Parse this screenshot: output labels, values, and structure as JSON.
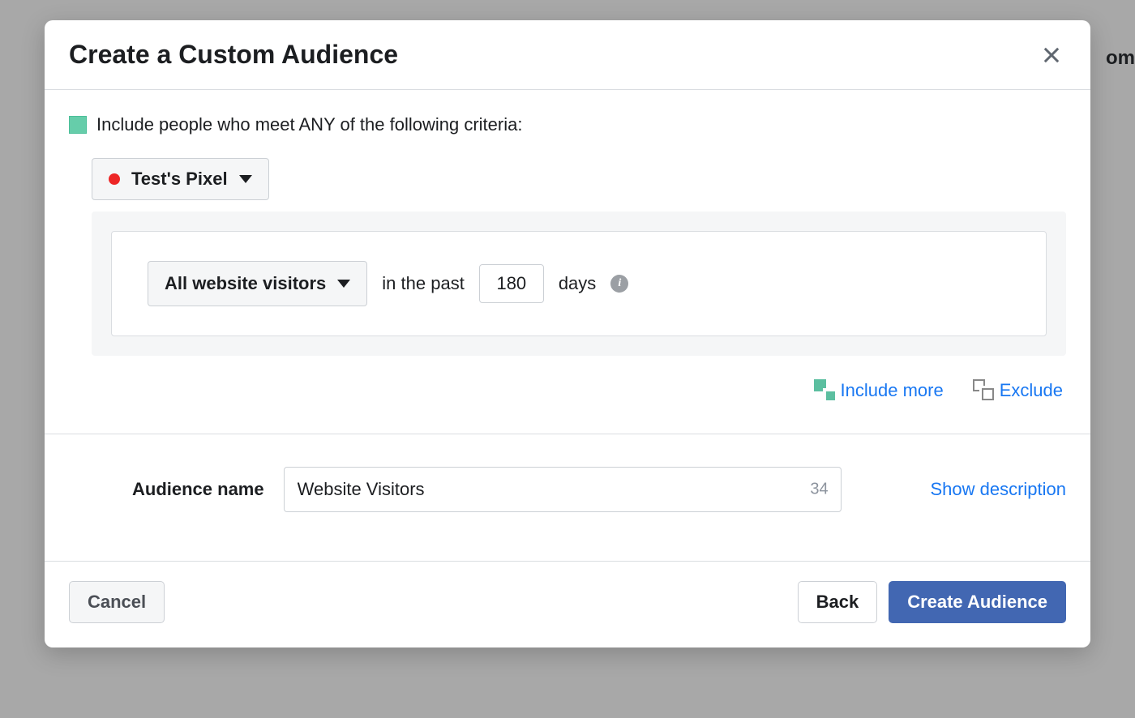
{
  "backdrop": {
    "partialText": "om"
  },
  "modal": {
    "title": "Create a Custom Audience",
    "criteria": {
      "headerText": "Include people who meet ANY of the following criteria:",
      "pixelDropdown": {
        "label": "Test's Pixel"
      },
      "visitorsDropdown": {
        "label": "All website visitors"
      },
      "pastLabel": "in the past",
      "daysValue": "180",
      "daysLabel": "days"
    },
    "actions": {
      "includeMore": "Include more",
      "exclude": "Exclude"
    },
    "audienceName": {
      "label": "Audience name",
      "value": "Website Visitors",
      "counter": "34",
      "showDescription": "Show description"
    },
    "footer": {
      "cancel": "Cancel",
      "back": "Back",
      "createAudience": "Create Audience"
    }
  }
}
